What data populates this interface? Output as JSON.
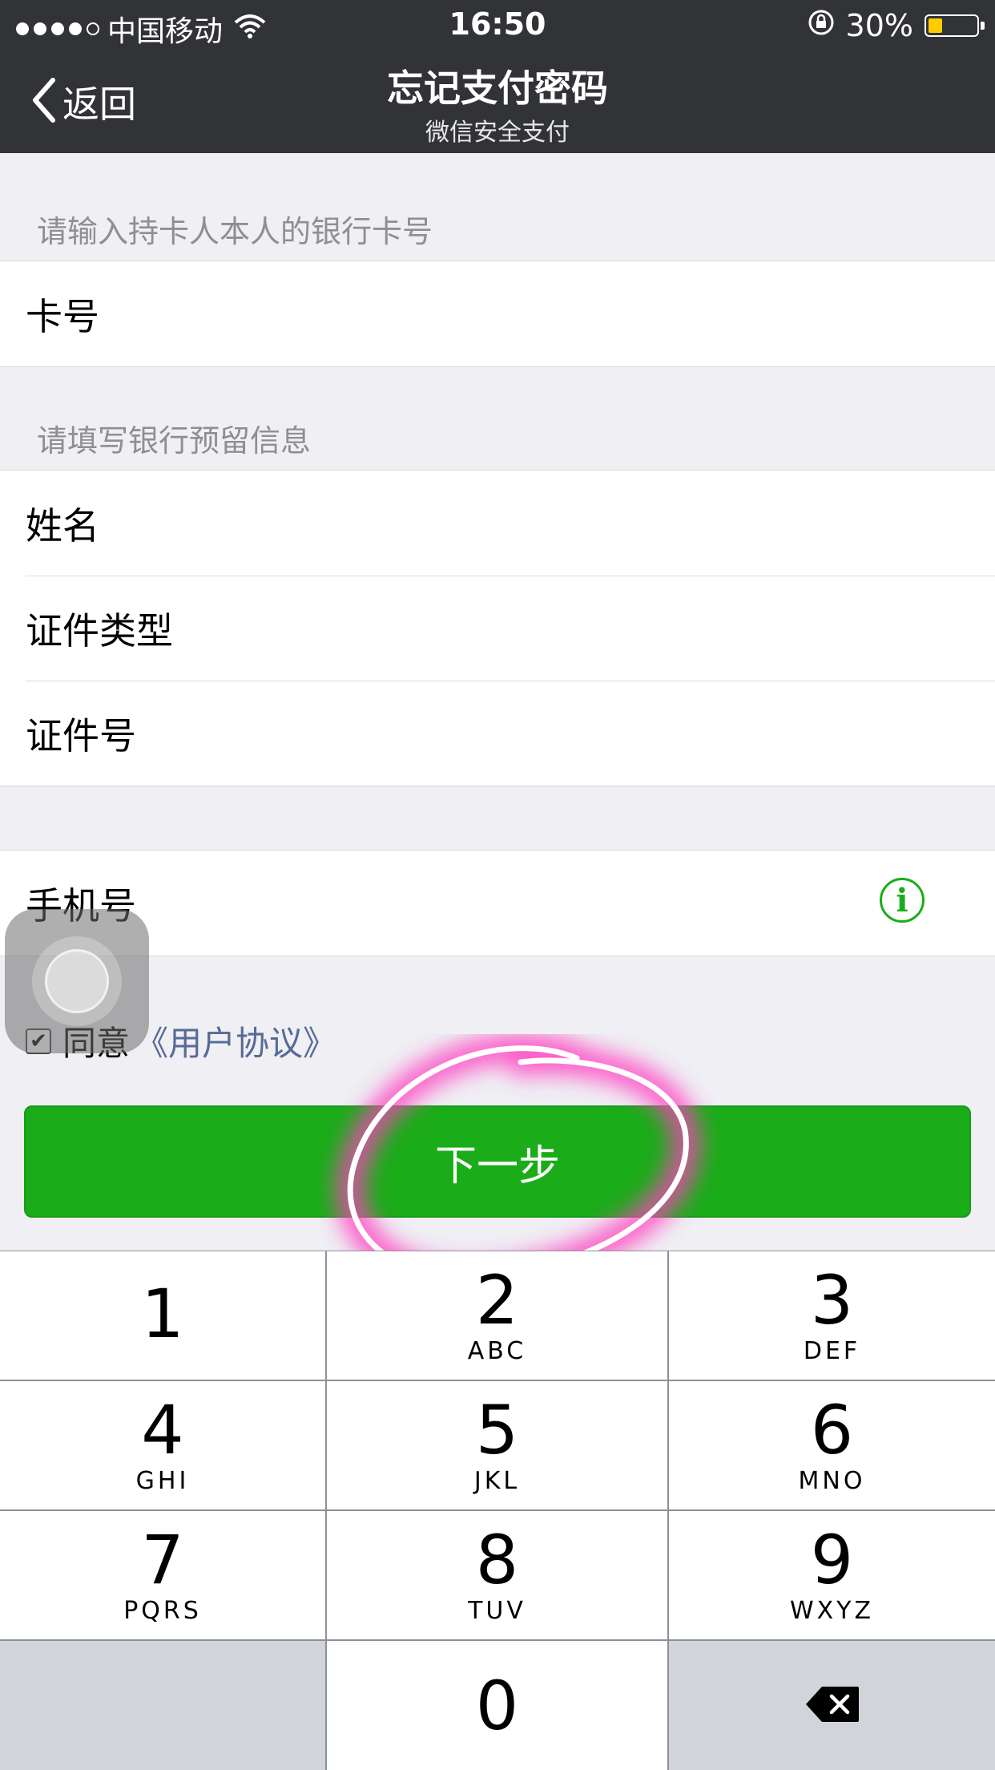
{
  "status_bar": {
    "carrier": "中国移动",
    "time": "16:50",
    "battery_percent": "30%",
    "battery_level": 0.3,
    "battery_color": "#ffcc00"
  },
  "nav": {
    "back_label": "返回",
    "title": "忘记支付密码",
    "subtitle": "微信安全支付"
  },
  "form": {
    "card_section_header": "请输入持卡人本人的银行卡号",
    "card_label": "卡号",
    "bank_info_header": "请填写银行预留信息",
    "name_label": "姓名",
    "id_type_label": "证件类型",
    "id_number_label": "证件号",
    "phone_label": "手机号",
    "info_icon": "info-icon"
  },
  "agreement": {
    "checked": true,
    "text": "同意",
    "link": "《用户协议》"
  },
  "next_button": {
    "label": "下一步",
    "color": "#1aad19"
  },
  "keypad": {
    "keys": [
      {
        "digit": "1",
        "letters": ""
      },
      {
        "digit": "2",
        "letters": "ABC"
      },
      {
        "digit": "3",
        "letters": "DEF"
      },
      {
        "digit": "4",
        "letters": "GHI"
      },
      {
        "digit": "5",
        "letters": "JKL"
      },
      {
        "digit": "6",
        "letters": "MNO"
      },
      {
        "digit": "7",
        "letters": "PQRS"
      },
      {
        "digit": "8",
        "letters": "TUV"
      },
      {
        "digit": "9",
        "letters": "WXYZ"
      },
      {
        "digit": "0",
        "letters": ""
      }
    ],
    "delete_icon": "backspace-icon"
  }
}
